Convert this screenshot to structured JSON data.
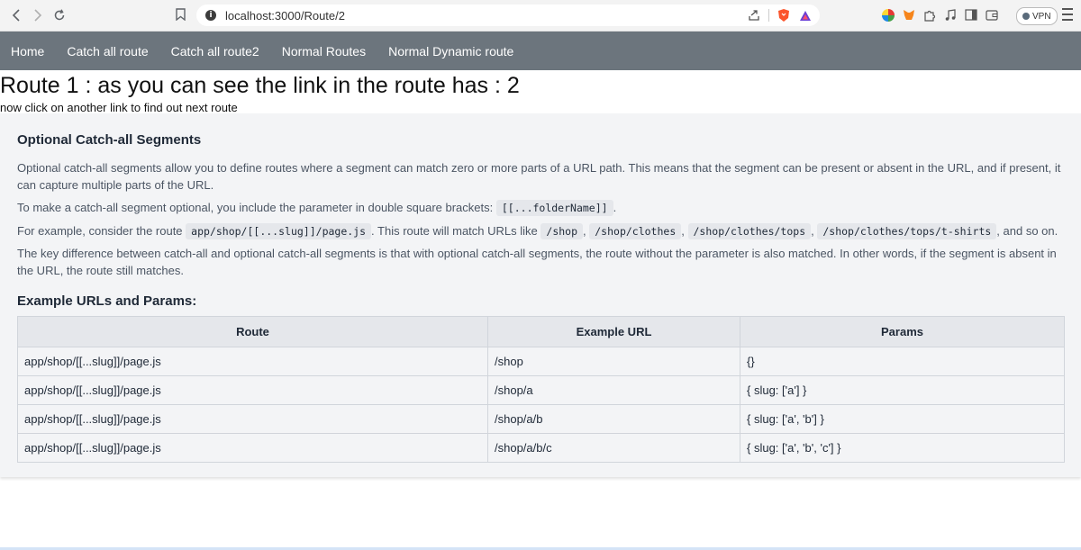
{
  "browser": {
    "url": "localhost:3000/Route/2",
    "vpn_label": "VPN"
  },
  "nav": {
    "links": [
      "Home",
      "Catch all route",
      "Catch all route2",
      "Normal Routes",
      "Normal Dynamic route"
    ]
  },
  "page": {
    "heading": "Route 1 : as you can see the link in the route has : 2",
    "subtext": "now click on another link to find out next route"
  },
  "card": {
    "title": "Optional Catch-all Segments",
    "p1": "Optional catch-all segments allow you to define routes where a segment can match zero or more parts of a URL path. This means that the segment can be present or absent in the URL, and if present, it can capture multiple parts of the URL.",
    "p2_text": "To make a catch-all segment optional, you include the parameter in double square brackets:",
    "p2_code": "[[...folderName]]",
    "p2_end": ".",
    "p3_pre": "For example, consider the route",
    "p3_code_route": "app/shop/[[...slug]]/page.js",
    "p3_mid": ". This route will match URLs like",
    "p3_urls": [
      "/shop",
      "/shop/clothes",
      "/shop/clothes/tops",
      "/shop/clothes/tops/t-shirts"
    ],
    "p3_end": ", and so on.",
    "p4": "The key difference between catch-all and optional catch-all segments is that with optional catch-all segments, the route without the parameter is also matched. In other words, if the segment is absent in the URL, the route still matches.",
    "examples_title": "Example URLs and Params:",
    "table": {
      "headers": [
        "Route",
        "Example URL",
        "Params"
      ],
      "rows": [
        [
          "app/shop/[[...slug]]/page.js",
          "/shop",
          "{}"
        ],
        [
          "app/shop/[[...slug]]/page.js",
          "/shop/a",
          "{ slug: ['a'] }"
        ],
        [
          "app/shop/[[...slug]]/page.js",
          "/shop/a/b",
          "{ slug: ['a', 'b'] }"
        ],
        [
          "app/shop/[[...slug]]/page.js",
          "/shop/a/b/c",
          "{ slug: ['a', 'b', 'c'] }"
        ]
      ]
    }
  }
}
